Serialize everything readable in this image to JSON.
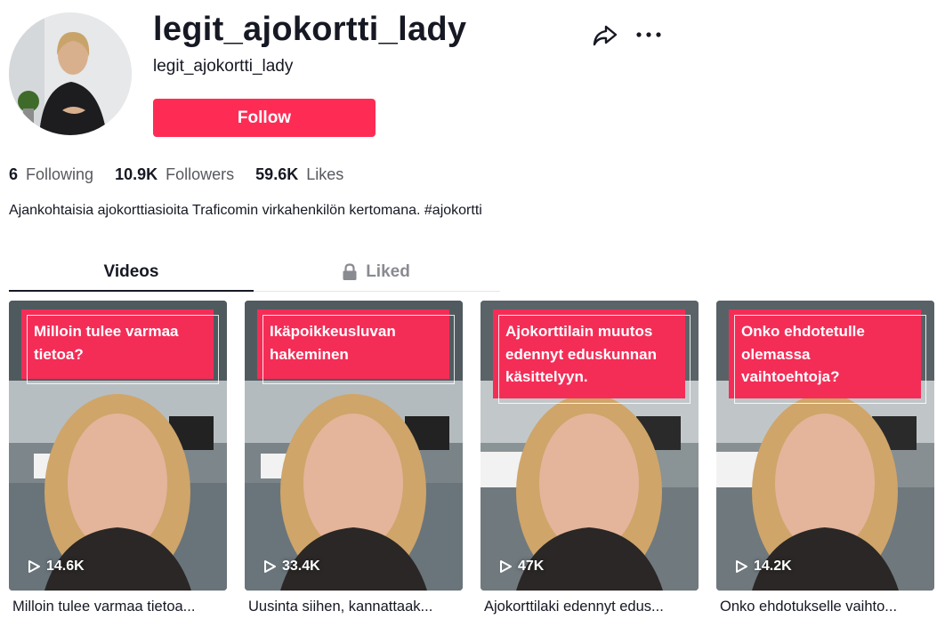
{
  "profile": {
    "title": "legit_ajokortti_lady",
    "subtitle": "legit_ajokortti_lady",
    "follow_label": "Follow",
    "bio": "Ajankohtaisia ajokorttiasioita Traficomin virkahenkilön kertomana. #ajokortti"
  },
  "stats": [
    {
      "value": "6",
      "label": "Following"
    },
    {
      "value": "10.9K",
      "label": "Followers"
    },
    {
      "value": "59.6K",
      "label": "Likes"
    }
  ],
  "tabs": {
    "videos": "Videos",
    "liked": "Liked"
  },
  "videos": [
    {
      "caption": "Milloin tulee varmaa tietoa?",
      "views": "14.6K",
      "description": "Milloin tulee varmaa tietoa..."
    },
    {
      "caption": "Ikäpoikkeusluvan hakeminen",
      "views": "33.4K",
      "description": "Uusinta siihen, kannattaak..."
    },
    {
      "caption": "Ajokorttilain muutos edennyt eduskunnan käsittelyyn.",
      "views": "47K",
      "description": "Ajokorttilaki edennyt edus..."
    },
    {
      "caption": "Onko ehdotetulle olemassa vaihtoehtoja?",
      "views": "14.2K",
      "description": "Onko ehdotukselle vaihto..."
    }
  ],
  "icons": {
    "share": "share-icon",
    "more": "more-icon",
    "lock": "lock-icon",
    "play": "play-icon"
  },
  "colors": {
    "accent": "#fe2c55",
    "caption_bg": "#f42d57",
    "text": "#161823",
    "muted": "#8a8b91"
  }
}
